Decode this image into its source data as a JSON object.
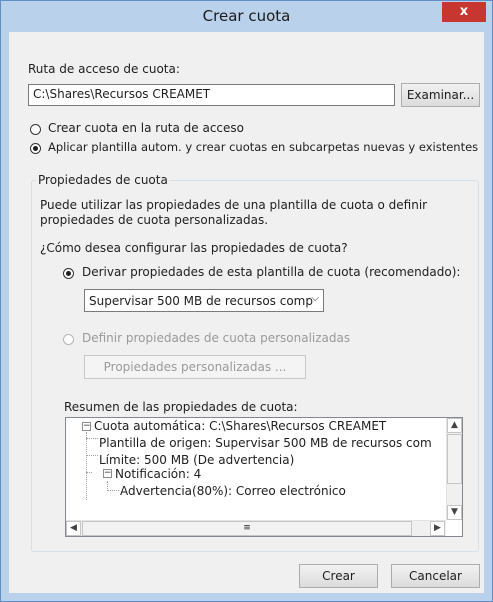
{
  "window": {
    "title": "Crear cuota",
    "close_label": "x"
  },
  "path": {
    "label": "Ruta de acceso de cuota:",
    "value": "C:\\Shares\\Recursos CREAMET",
    "browse_label": "Examinar..."
  },
  "mode_options": [
    {
      "label": "Crear cuota en la ruta de acceso",
      "checked": false
    },
    {
      "label": "Aplicar plantilla autom. y crear cuotas en subcarpetas nuevas y existentes",
      "checked": true
    }
  ],
  "properties": {
    "legend": "Propiedades de cuota",
    "description_line1": "Puede utilizar las propiedades de una plantilla de cuota o definir",
    "description_line2": "propiedades de cuota personalizadas.",
    "question": "¿Cómo desea configurar las propiedades de cuota?",
    "derive_option": "Derivar propiedades de esta plantilla de cuota (recomendado):",
    "template_select_value": "Supervisar 500 MB de recursos comp",
    "define_option": "Definir propiedades de cuota personalizadas",
    "custom_button_label": "Propiedades personalizadas ...",
    "summary_label": "Resumen de las propiedades de cuota:"
  },
  "summary_tree": {
    "root": "Cuota automática: C:\\Shares\\Recursos CREAMET",
    "source_template": "Plantilla de origen: Supervisar 500 MB de recursos com",
    "limit": "Límite: 500 MB (De advertencia)",
    "notification": "Notificación: 4",
    "warning": "Advertencia(80%): Correo electrónico"
  },
  "footer": {
    "create_label": "Crear",
    "cancel_label": "Cancelar"
  }
}
